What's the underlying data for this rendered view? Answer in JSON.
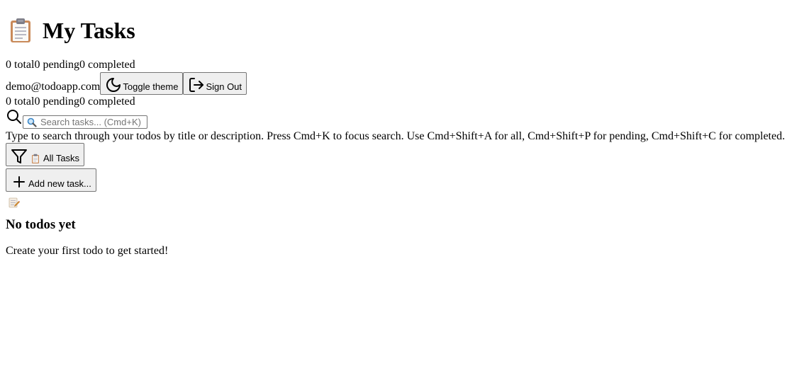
{
  "header": {
    "title": "My Tasks",
    "icon": "clipboard-icon"
  },
  "stats_top": {
    "total": "0 total",
    "pending": "0 pending",
    "completed": "0 completed"
  },
  "user": {
    "email": "demo@todoapp.com",
    "toggle_theme_label": "Toggle theme",
    "sign_out_label": "Sign Out"
  },
  "stats_bottom": {
    "total": "0 total",
    "pending": "0 pending",
    "completed": "0 completed"
  },
  "search": {
    "placeholder": "Search tasks... (Cmd+K)",
    "value": "",
    "help": "Type to search through your todos by title or description. Press Cmd+K to focus search. Use Cmd+Shift+A for all, Cmd+Shift+P for pending, Cmd+Shift+C for completed."
  },
  "filter": {
    "selected_label": "All Tasks"
  },
  "add_task": {
    "label": "Add new task..."
  },
  "empty_state": {
    "icon": "memo-icon",
    "title": "No todos yet",
    "text": "Create your first todo to get started!"
  }
}
